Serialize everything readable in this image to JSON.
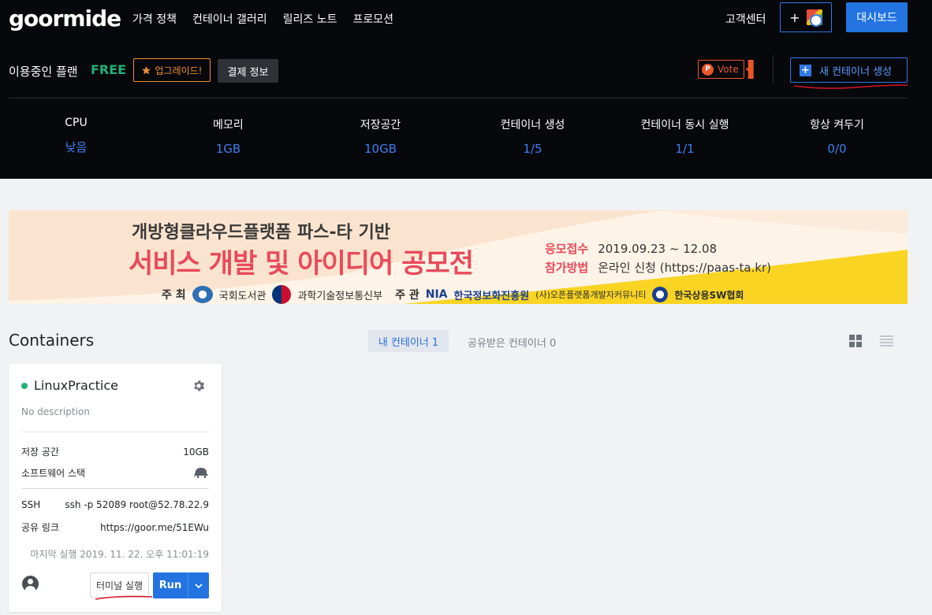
{
  "header": {
    "logo": "goormide",
    "nav": [
      "가격 정책",
      "컨테이너 갤러리",
      "릴리즈 노트",
      "프로모션"
    ],
    "support": "고객센터",
    "plus_label": "+",
    "dashboard": "대시보드"
  },
  "plan": {
    "label": "이용중인 플랜",
    "value": "FREE",
    "upgrade": "업그레이드!",
    "billing": "결제 정보",
    "vote": "Vote",
    "new_container": "새 컨테이너 생성"
  },
  "stats": [
    {
      "label": "CPU",
      "value": "낮음"
    },
    {
      "label": "메모리",
      "value": "1GB"
    },
    {
      "label": "저장공간",
      "value": "10GB"
    },
    {
      "label": "컨테이너 생성",
      "value": "1/5"
    },
    {
      "label": "컨테이너 동시 실행",
      "value": "1/1"
    },
    {
      "label": "항상 켜두기",
      "value": "0/0"
    }
  ],
  "banner": {
    "subtitle": "개방형클라우드플랫폼 파스-타 기반",
    "title": "서비스 개발 및 아이디어 공모전",
    "info1_key": "응모접수",
    "info1_val": "2019.09.23 ~ 12.08",
    "info2_key": "참가방법",
    "info2_val": "온라인 신청 (https://paas-ta.kr)",
    "host_label": "주 최",
    "host1": "국회도서관",
    "host2": "과학기술정보통신부",
    "organizer_label": "주 관",
    "org1_abbr": "NIA",
    "org1": "한국정보화진흥원",
    "org2": "(사)오픈플랫폼개발자커뮤니티",
    "org3": "한국상용SW협회"
  },
  "containers": {
    "title": "Containers",
    "tab_mine": "내 컨테이너 1",
    "tab_shared": "공유받은 컨테이너 0"
  },
  "card": {
    "name": "LinuxPractice",
    "description": "No description",
    "storage_label": "저장 공간",
    "storage_value": "10GB",
    "stack_label": "소프트웨어 스택",
    "ssh_label": "SSH",
    "ssh_value": "ssh -p 52089 root@52.78.22.9",
    "share_label": "공유 링크",
    "share_value": "https://goor.me/51EWu",
    "last_run": "마지막 실행 2019. 11. 22. 오후 11:01:19",
    "terminal": "터미널 실행",
    "run": "Run"
  },
  "colors": {
    "accent": "#2374e1",
    "free": "#1fb079",
    "upgrade": "#f08f2c",
    "vote": "#e9562a",
    "banner_red": "#e94a5a"
  }
}
